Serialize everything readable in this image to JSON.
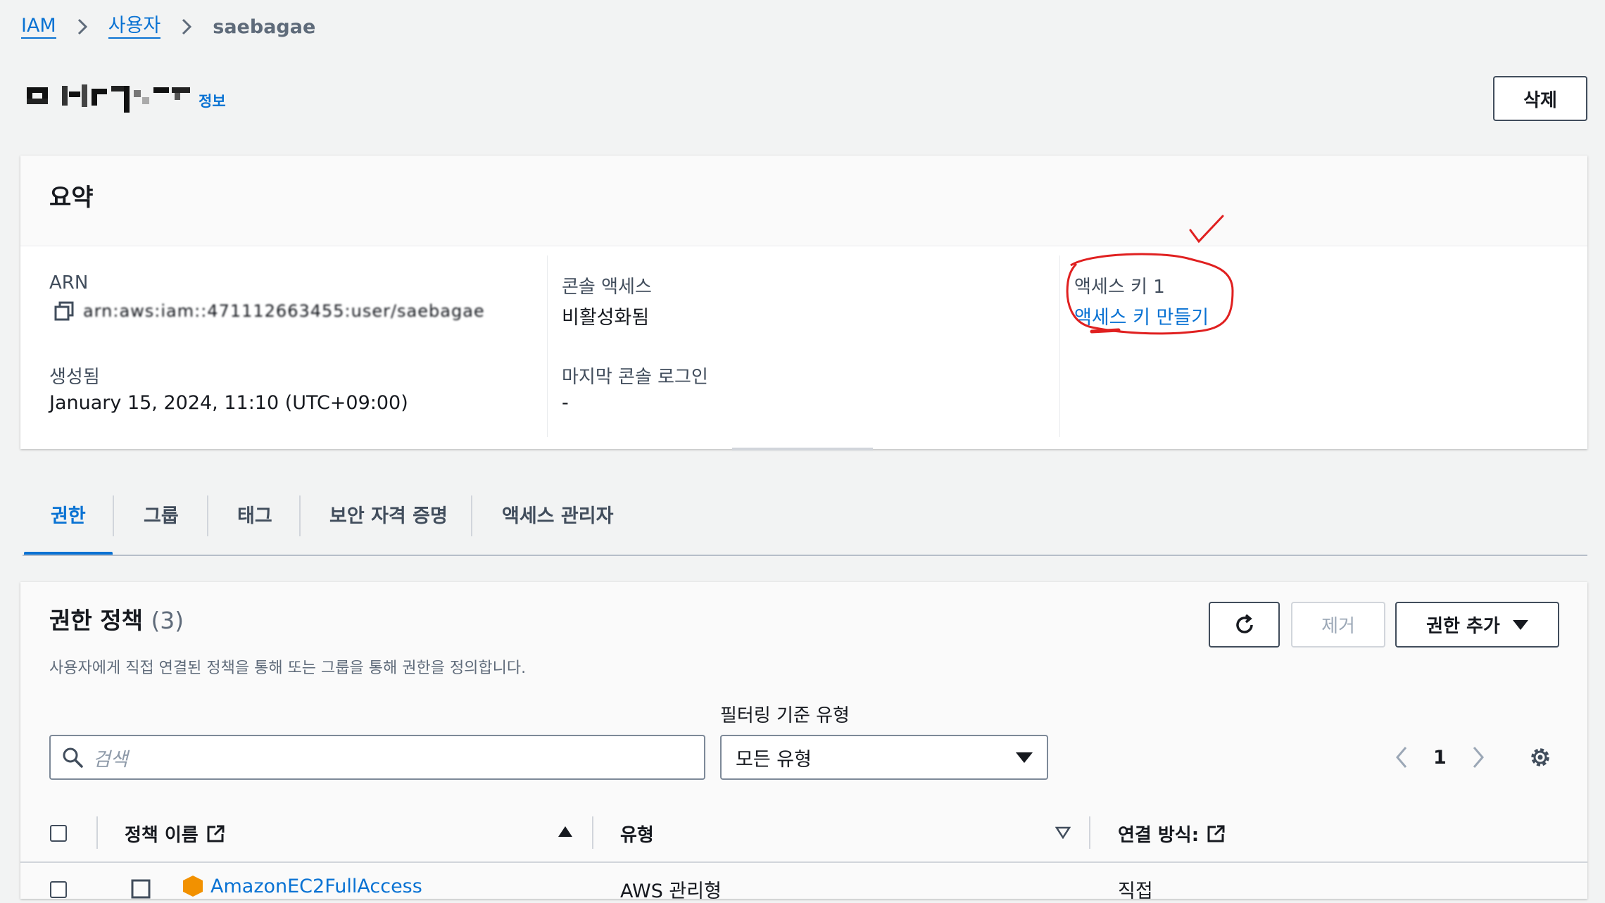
{
  "breadcrumb": {
    "root": "IAM",
    "users": "사용자",
    "current": "saebagae"
  },
  "title": {
    "info": "정보"
  },
  "actions": {
    "delete": "삭제"
  },
  "summary": {
    "heading": "요약",
    "arn_label": "ARN",
    "arn_value": "arn:aws:iam::471112663455:user/saebagae",
    "created_label": "생성됨",
    "created_value": "January 15, 2024, 11:10 (UTC+09:00)",
    "console_access_label": "콘솔 액세스",
    "console_access_value": "비활성화됨",
    "last_login_label": "마지막 콘솔 로그인",
    "last_login_value": "-",
    "access_key_label": "액세스 키 1",
    "access_key_link": "액세스 키 만들기",
    "annotation_color": "#e02020"
  },
  "tabs": [
    {
      "label": "권한"
    },
    {
      "label": "그룹"
    },
    {
      "label": "태그"
    },
    {
      "label": "보안 자격 증명"
    },
    {
      "label": "액세스 관리자"
    }
  ],
  "permissions": {
    "heading": "권한 정책",
    "count": "(3)",
    "description": "사용자에게 직접 연결된 정책을 통해 또는 그룹을 통해 권한을 정의합니다.",
    "remove": "제거",
    "add": "권한 추가",
    "filter_label": "필터링 기준 유형",
    "search_placeholder": "검색",
    "filter_value": "모든 유형",
    "page": "1",
    "columns": {
      "name": "정책 이름",
      "type": "유형",
      "attached": "연결 방식:"
    },
    "first_row": {
      "name": "AmazonEC2FullAccess",
      "type": "AWS 관리형",
      "attached": "직접"
    }
  },
  "colors": {
    "link": "#0972d3",
    "text": "#16191f",
    "background": "#f2f3f3"
  }
}
